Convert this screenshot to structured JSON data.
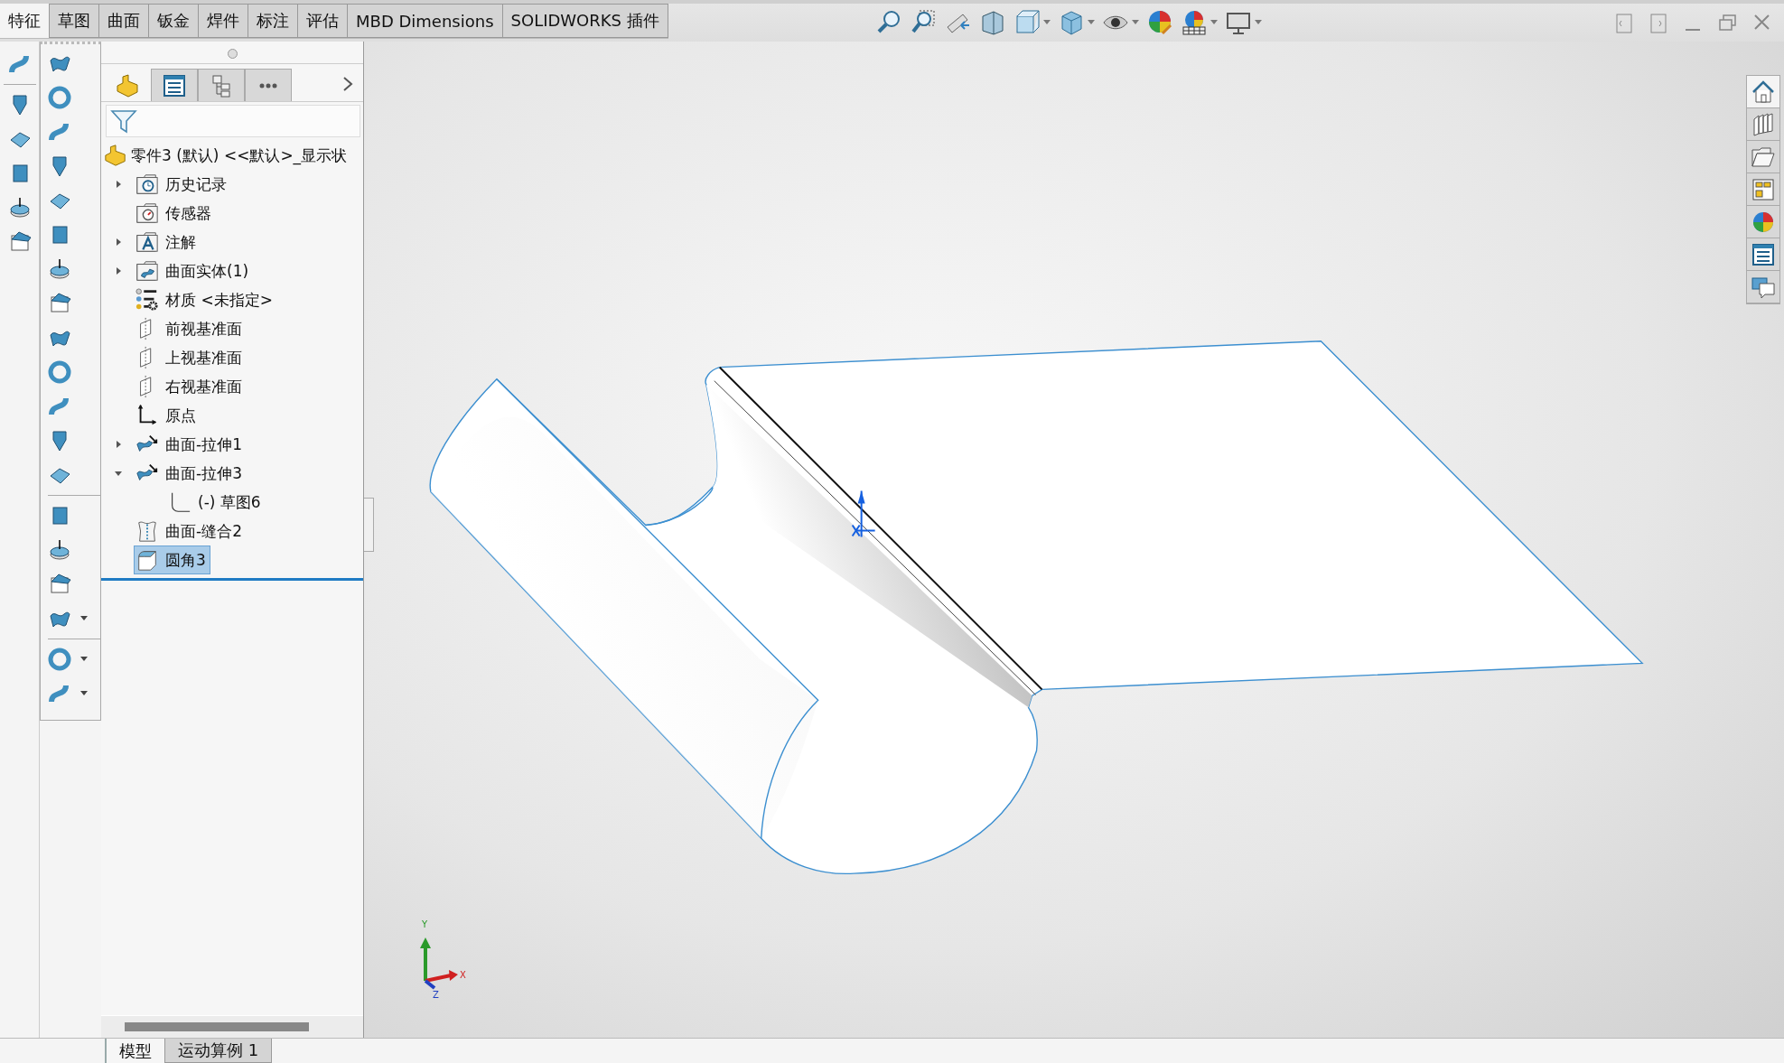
{
  "command_tabs": [
    {
      "label": "特征",
      "selected": true
    },
    {
      "label": "草图",
      "selected": false
    },
    {
      "label": "曲面",
      "selected": false
    },
    {
      "label": "钣金",
      "selected": false
    },
    {
      "label": "焊件",
      "selected": false
    },
    {
      "label": "标注",
      "selected": false
    },
    {
      "label": "评估",
      "selected": false
    },
    {
      "label": "MBD Dimensions",
      "selected": false
    },
    {
      "label": "SOLIDWORKS 插件",
      "selected": false
    }
  ],
  "manager_tabs": [
    {
      "kind": "features",
      "selected": true
    },
    {
      "kind": "properties",
      "selected": false
    },
    {
      "kind": "configurations",
      "selected": false
    },
    {
      "kind": "more",
      "selected": false
    }
  ],
  "feature_tree": {
    "root": {
      "label": "零件3 (默认) <<默认>_显示状",
      "kind": "part"
    },
    "items": [
      {
        "label": "历史记录",
        "kind": "history",
        "expanded": false,
        "selected": false
      },
      {
        "label": "传感器",
        "kind": "sensor",
        "selected": false
      },
      {
        "label": "注解",
        "kind": "annotation",
        "expanded": false,
        "selected": false
      },
      {
        "label": "曲面实体(1)",
        "kind": "bodies",
        "expanded": false,
        "selected": false
      },
      {
        "label": "材质 <未指定>",
        "kind": "material",
        "selected": false
      },
      {
        "label": "前视基准面",
        "kind": "plane",
        "selected": false
      },
      {
        "label": "上视基准面",
        "kind": "plane",
        "selected": false
      },
      {
        "label": "右视基准面",
        "kind": "plane",
        "selected": false
      },
      {
        "label": "原点",
        "kind": "origin",
        "selected": false
      },
      {
        "label": "曲面-拉伸1",
        "kind": "extrude",
        "expanded": false,
        "selected": false
      },
      {
        "label": "曲面-拉伸3",
        "kind": "extrude",
        "expanded": true,
        "selected": false,
        "children": [
          {
            "label": "(-) 草图6",
            "kind": "sketch",
            "selected": false
          }
        ]
      },
      {
        "label": "曲面-缝合2",
        "kind": "knit",
        "selected": false
      },
      {
        "label": "圆角3",
        "kind": "fillet",
        "selected": true
      }
    ]
  },
  "triad": {
    "y": "Y",
    "x": "X",
    "z": "Z"
  },
  "task_pane": [
    {
      "kind": "home",
      "selected": true
    },
    {
      "kind": "library",
      "selected": false
    },
    {
      "kind": "files",
      "selected": false
    },
    {
      "kind": "views",
      "selected": false
    },
    {
      "kind": "appearances",
      "selected": false
    },
    {
      "kind": "properties",
      "selected": false
    },
    {
      "kind": "forum",
      "selected": false
    }
  ],
  "bottom_tabs": [
    {
      "label": "模型",
      "selected": true
    },
    {
      "label": "运动算例 1",
      "selected": false
    }
  ]
}
